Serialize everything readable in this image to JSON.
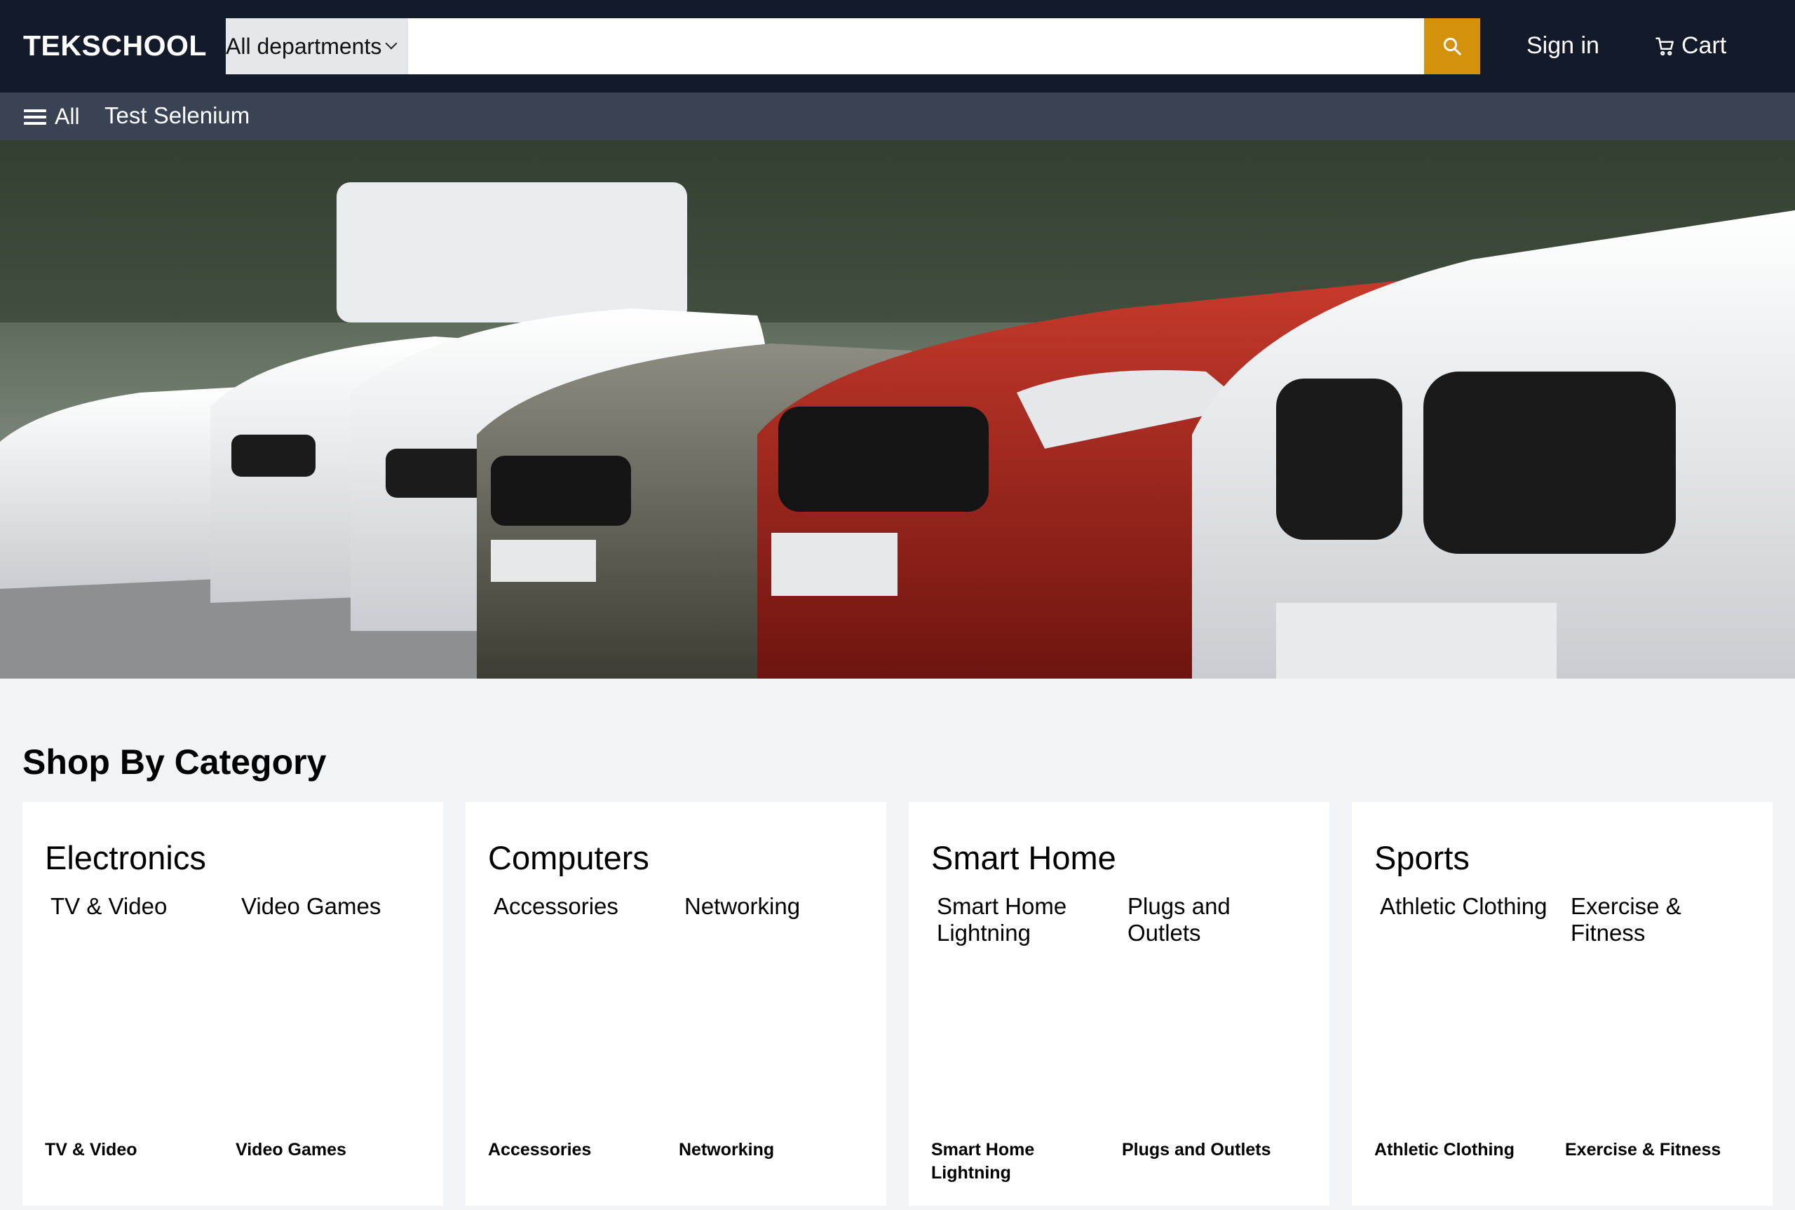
{
  "header": {
    "logo": "TEKSCHOOL",
    "department_select": "All departments",
    "search_value": "",
    "sign_in": "Sign in",
    "cart": "Cart",
    "accent": "#d4920a"
  },
  "subnav": {
    "all": "All",
    "link": "Test Selenium"
  },
  "hero": {
    "image": "row of parked cars (white, gray, red, white) banner"
  },
  "category": {
    "title": "Shop By Category",
    "cards": [
      {
        "title": "Electronics",
        "subs": [
          "TV & Video",
          "Video Games"
        ],
        "labels": [
          "TV & Video",
          "Video Games"
        ]
      },
      {
        "title": "Computers",
        "subs": [
          "Accessories",
          "Networking"
        ],
        "labels": [
          "Accessories",
          "Networking"
        ]
      },
      {
        "title": "Smart Home",
        "subs": [
          "Smart Home Lightning",
          "Plugs and Outlets"
        ],
        "labels": [
          "Smart Home Lightning",
          "Plugs and Outlets"
        ]
      },
      {
        "title": "Sports",
        "subs": [
          "Athletic Clothing",
          "Exercise & Fitness"
        ],
        "labels": [
          "Athletic Clothing",
          "Exercise & Fitness"
        ]
      }
    ]
  }
}
